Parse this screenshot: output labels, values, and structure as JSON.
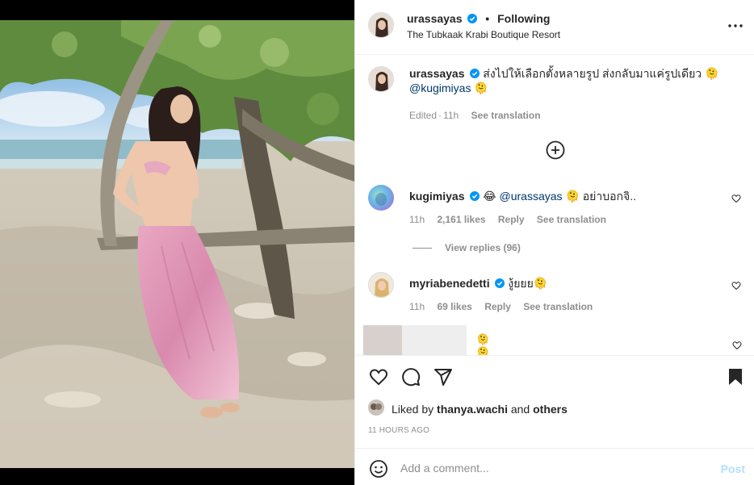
{
  "post": {
    "username": "urassayas",
    "separator": "•",
    "follow_status": "Following",
    "location": "The Tubkaak Krabi Boutique Resort",
    "more_icon": "more-horizontal-icon"
  },
  "caption": {
    "username": "urassayas",
    "text": "ส่งไปให้เลือกตั้งหลายรูป ส่งกลับมาแค่รูปเดียว 🫠",
    "mention": "@kugimiyas",
    "mention_suffix": "🫠",
    "edited": "Edited",
    "time": "11h",
    "see_translation": "See translation"
  },
  "comments": [
    {
      "username": "kugimiyas",
      "emoji": "😂",
      "mention": "@urassayas",
      "text": "🫠 อย่าบอกจิ..",
      "time": "11h",
      "likes": "2,161 likes",
      "reply": "Reply",
      "see_translation": "See translation",
      "view_replies": "View replies (96)"
    },
    {
      "username": "myriabenedetti",
      "text": "งู้ยยย🫠",
      "time": "11h",
      "likes": "69 likes",
      "reply": "Reply",
      "see_translation": "See translation"
    },
    {
      "text": "🫠🫠🫠🫠🫠🫠"
    }
  ],
  "actions": {
    "like_icon": "heart-icon",
    "comment_icon": "comment-icon",
    "share_icon": "send-icon",
    "save_icon": "bookmark-icon"
  },
  "likes": {
    "prefix": "Liked by",
    "user": "thanya.wachi",
    "conj": "and",
    "others": "others"
  },
  "timestamp": "11 HOURS AGO",
  "add_comment": {
    "placeholder": "Add a comment...",
    "post_label": "Post"
  },
  "colors": {
    "verified": "#0095f6",
    "link": "#00376b",
    "muted": "#8e8e8e",
    "post_disabled": "#b2dffc"
  }
}
